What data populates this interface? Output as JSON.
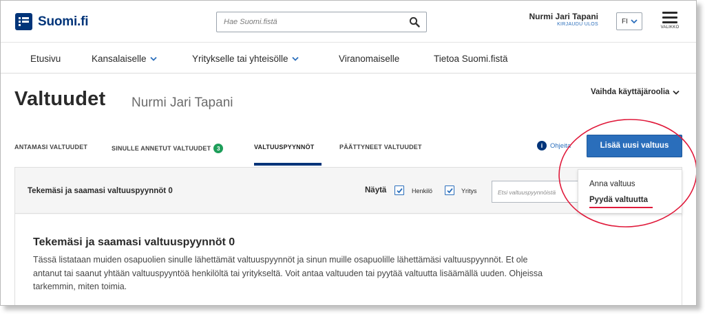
{
  "header": {
    "logo_text": "Suomi.fi",
    "search_placeholder": "Hae Suomi.fistä",
    "user_name": "Nurmi Jari Tapani",
    "logout_label": "KIRJAUDU ULOS",
    "language": "FI",
    "menu_label": "VALIKKO"
  },
  "nav": {
    "items": [
      {
        "label": "Etusivu"
      },
      {
        "label": "Kansalaiselle"
      },
      {
        "label": "Yritykselle tai yhteisölle"
      },
      {
        "label": "Viranomaiselle"
      },
      {
        "label": "Tietoa Suomi.fistä"
      }
    ]
  },
  "page": {
    "title": "Valtuudet",
    "subtitle": "Nurmi Jari Tapani",
    "role_switch": "Vaihda käyttäjäroolia"
  },
  "tabs": [
    {
      "label": "ANTAMASI VALTUUDET"
    },
    {
      "label": "SINULLE ANNETUT VALTUUDET",
      "badge": "3"
    },
    {
      "label": "VALTUUSPYYNNÖT"
    },
    {
      "label": "PÄÄTTYNEET VALTUUDET"
    }
  ],
  "help_label": "Ohjeita",
  "add_button_label": "Lisää uusi valtuus",
  "dropdown": {
    "items": [
      {
        "label": "Anna valtuus"
      },
      {
        "label": "Pyydä valtuutta"
      }
    ]
  },
  "panel": {
    "title": "Tekemäsi ja saamasi valtuuspyynnöt  0",
    "show_label": "Näytä",
    "filters": [
      {
        "label": "Henkilö",
        "checked": true
      },
      {
        "label": "Yritys",
        "checked": true
      }
    ],
    "filter_placeholder": "Etsi valtuuspyynnöistä",
    "card_title": "Tekemäsi ja saamasi valtuuspyynnöt   0",
    "card_text": "Tässä listataan muiden osapuolien sinulle lähettämät valtuuspyynnöt ja sinun muille osapuolille lähettämäsi valtuuspyynnöt. Et ole antanut tai saanut yhtään valtuuspyyntöä henkilöltä tai yritykseltä. Voit antaa valtuuden tai pyytää valtuutta lisäämällä uuden. Ohjeissa tarkemmin, miten toimia."
  },
  "colors": {
    "brand": "#003479",
    "accent": "#2a6ebb",
    "badge": "#1e9e5a",
    "annotation": "#e0193a"
  }
}
